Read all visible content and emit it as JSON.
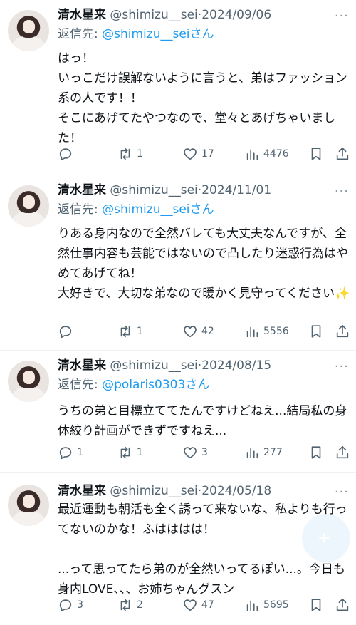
{
  "tweets": [
    {
      "name": "清水星来",
      "handle": "@shimizu__sei",
      "sep": "·",
      "date": "2024/09/06",
      "reply_prefix": "返信先: ",
      "reply_to": "@shimizu__sei",
      "reply_suffix": "さん",
      "text": "はっ！\nいっこだけ誤解ないように言うと、弟はファッション系の人です！！\nそこにあげてたやつなので、堂々とあげちゃいました！",
      "replies": "",
      "retweets": "1",
      "likes": "17",
      "views": "4476"
    },
    {
      "name": "清水星来",
      "handle": "@shimizu__sei",
      "sep": "·",
      "date": "2024/11/01",
      "reply_prefix": "返信先: ",
      "reply_to": "@shimizu__sei",
      "reply_suffix": "さん",
      "text": "りある身内なので全然バレても大丈夫なんですが、全然仕事内容も芸能ではないので凸したり迷惑行為はやめてあげてね！\n大好きで、大切な弟なので暖かく見守ってください✨",
      "replies": "",
      "retweets": "1",
      "likes": "42",
      "views": "5556"
    },
    {
      "name": "清水星来",
      "handle": "@shimizu__sei",
      "sep": "·",
      "date": "2024/08/15",
      "reply_prefix": "返信先: ",
      "reply_to": "@polaris0303",
      "reply_suffix": "さん",
      "text": "うちの弟と目標立ててたんですけどねえ...結局私の身体絞り計画ができずですねえ...",
      "replies": "1",
      "retweets": "1",
      "likes": "3",
      "views": "277"
    },
    {
      "name": "清水星来",
      "handle": "@shimizu__sei",
      "sep": "·",
      "date": "2024/05/18",
      "reply_prefix": "",
      "reply_to": "",
      "reply_suffix": "",
      "text": "最近運動も朝活も全く誘って来ないな、私よりも行ってないのかな！ふはははは！\n\n...って思ってたら弟のが全然いってるぽい...。今日も身内LOVE、、、お姉ちゃんグスン",
      "replies": "3",
      "retweets": "2",
      "likes": "47",
      "views": "5695"
    }
  ],
  "more_label": "···",
  "icons": {
    "reply": "reply-icon",
    "retweet": "retweet-icon",
    "like": "heart-icon",
    "views": "views-icon",
    "bookmark": "bookmark-icon",
    "share": "share-icon",
    "compose": "compose-icon"
  },
  "colors": {
    "link": "#1d9bf0",
    "muted": "#536471",
    "text": "#0f1419"
  }
}
